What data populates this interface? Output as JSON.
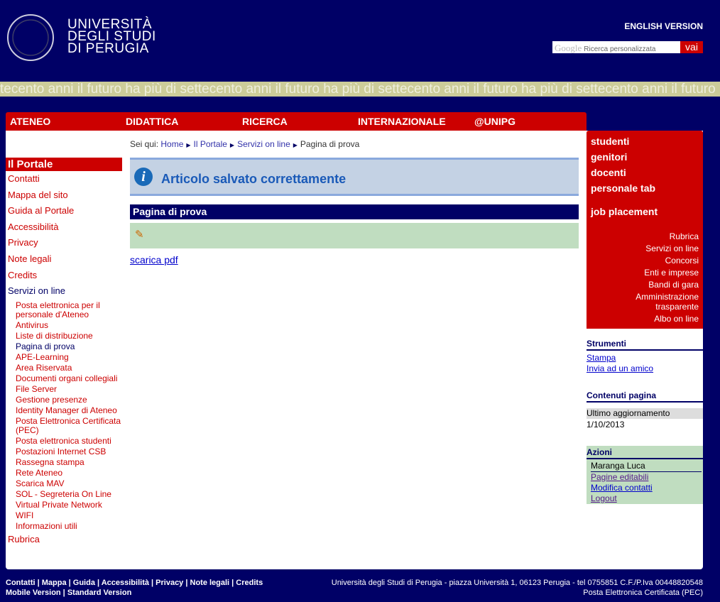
{
  "header": {
    "logo_text": [
      "UNIVERSITÀ",
      "DEGLI STUDI",
      "DI PERUGIA"
    ],
    "english_version": "ENGLISH VERSION",
    "search_brand": "Google",
    "search_placeholder": "Ricerca personalizzata",
    "search_button": "vai",
    "tagline": "tecento anni il futuro ha più di settecento anni il futuro ha più di settecento anni il futuro ha più di settecento anni il futuro ha più"
  },
  "nav": [
    "ATENEO",
    "DIDATTICA",
    "RICERCA",
    "INTERNAZIONALE",
    "@UNIPG"
  ],
  "sidebar": {
    "title": "Il Portale",
    "items": [
      "Contatti",
      "Mappa del sito",
      "Guida al Portale",
      "Accessibilità",
      "Privacy",
      "Note legali",
      "Credits",
      "Servizi on line"
    ],
    "sub": [
      "Posta elettronica per il personale d'Ateneo",
      "Antivirus",
      "Liste di distribuzione",
      "Pagina di prova",
      "APE-Learning",
      "Area Riservata",
      "Documenti organi collegiali",
      "File Server",
      "Gestione presenze",
      "Identity Manager di Ateneo",
      "Posta Elettronica Certificata (PEC)",
      "Posta elettronica studenti",
      "Postazioni Internet CSB",
      "Rassegna stampa",
      "Rete Ateneo",
      "Scarica MAV",
      "SOL - Segreteria On Line",
      "Virtual Private Network",
      "WIFI",
      "Informazioni utili"
    ],
    "last": "Rubrica"
  },
  "breadcrumb": {
    "prefix": "Sei qui:",
    "items": [
      "Home",
      "Il Portale",
      "Servizi on line",
      "Pagina di prova"
    ]
  },
  "main": {
    "message": "Articolo salvato correttamente",
    "page_title": "Pagina di prova",
    "pdf_link": "scarica pdf"
  },
  "right": {
    "big": [
      "studenti",
      "genitori",
      "docenti",
      "personale tab",
      "job placement"
    ],
    "small": [
      "Rubrica",
      "Servizi on line",
      "Concorsi",
      "Enti e imprese",
      "Bandi di gara",
      "Amministrazione trasparente",
      "Albo on line"
    ],
    "strumenti": {
      "title": "Strumenti",
      "links": [
        "Stampa",
        "Invia ad un amico"
      ]
    },
    "contenuti": {
      "title": "Contenuti pagina",
      "label": "Ultimo aggiornamento",
      "date": "1/10/2013"
    },
    "azioni": {
      "title": "Azioni",
      "user": "Maranga Luca",
      "links": [
        "Pagine editabili",
        "Modifica contatti",
        "Logout"
      ]
    }
  },
  "footer": {
    "links1": "Contatti | Mappa | Guida | Accessibilità | Privacy | Note legali | Credits",
    "links2": "Mobile Version | Standard Version",
    "address": "Università degli Studi di Perugia - piazza Università 1, 06123 Perugia - tel 0755851 C.F./P.Iva 00448820548",
    "pec": "Posta Elettronica Certificata (PEC)"
  },
  "colors": {
    "navy": "#000066",
    "red": "#cc0000",
    "tagline": "#cccc99"
  }
}
